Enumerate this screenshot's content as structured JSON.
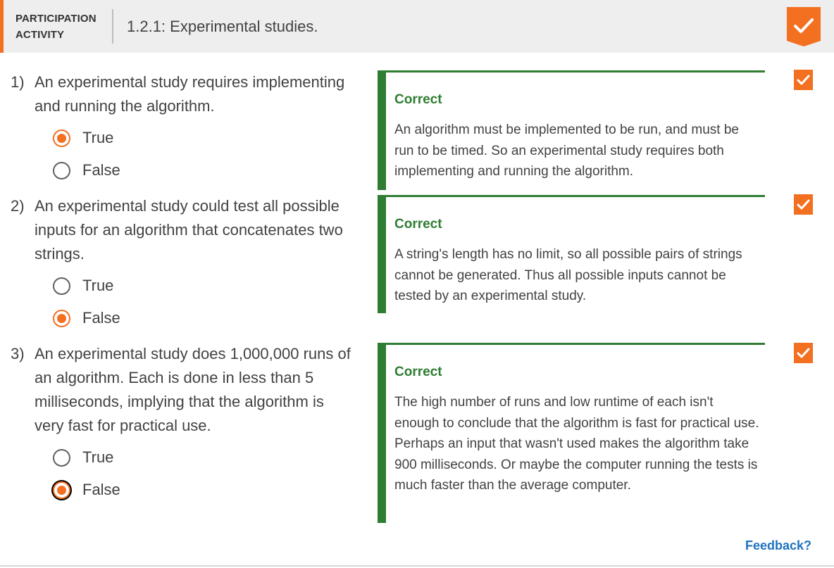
{
  "header": {
    "label_line1": "PARTICIPATION",
    "label_line2": "ACTIVITY",
    "title": "1.2.1: Experimental studies."
  },
  "colors": {
    "accent": "#f37021",
    "correct": "#2e7d32",
    "link": "#1e73be"
  },
  "questions": [
    {
      "number": "1)",
      "text": "An experimental study requires implementing and running the algorithm.",
      "options": [
        "True",
        "False"
      ],
      "selected": "True",
      "feedback_title": "Correct",
      "feedback_text": "An algorithm must be implemented to be run, and must be run to be timed. So an experimental study requires both implementing and running the algorithm."
    },
    {
      "number": "2)",
      "text": "An experimental study could test all possible inputs for an algorithm that concatenates two strings.",
      "options": [
        "True",
        "False"
      ],
      "selected": "False",
      "feedback_title": "Correct",
      "feedback_text": "A string's length has no limit, so all possible pairs of strings cannot be generated. Thus all possible inputs cannot be tested by an experimental study."
    },
    {
      "number": "3)",
      "text": "An experimental study does 1,000,000 runs of an algorithm. Each is done in less than 5 milliseconds, implying that the algorithm is very fast for practical use.",
      "options": [
        "True",
        "False"
      ],
      "selected": "False",
      "feedback_title": "Correct",
      "feedback_text": "The high number of runs and low runtime of each isn't enough to conclude that the algorithm is fast for practical use. Perhaps an input that wasn't used makes the algorithm take 900 milliseconds. Or maybe the computer running the tests is much faster than the average computer."
    }
  ],
  "footer": {
    "feedback_link": "Feedback?"
  }
}
